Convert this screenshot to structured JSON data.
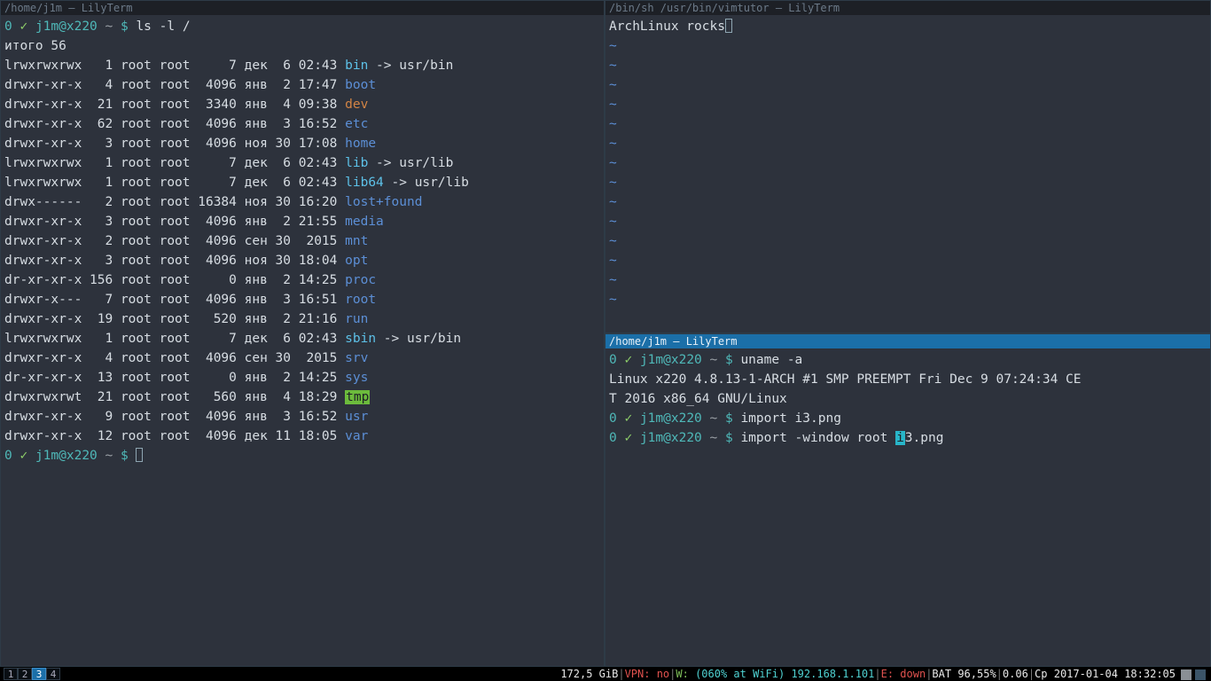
{
  "titles": {
    "left": "/home/j1m – LilyTerm",
    "topright": "/bin/sh /usr/bin/vimtutor – LilyTerm",
    "bottomright": "/home/j1m – LilyTerm"
  },
  "prompt": {
    "zero": "0",
    "check": "✓",
    "user": "j1m@x220",
    "path": "~",
    "sym": "$"
  },
  "left": {
    "cmd1": "ls -l /",
    "total": "итого 56",
    "rows": [
      {
        "perm": "lrwxrwxrwx",
        "n": "1",
        "own": "root",
        "grp": "root",
        "size": "7",
        "mon": "дек",
        "day": "6",
        "time": "02:43",
        "name": "bin",
        "link": " -> usr/bin",
        "cls": "fg-cyan"
      },
      {
        "perm": "drwxr-xr-x",
        "n": "4",
        "own": "root",
        "grp": "root",
        "size": "4096",
        "mon": "янв",
        "day": "2",
        "time": "17:47",
        "name": "boot",
        "link": "",
        "cls": "fg-blue"
      },
      {
        "perm": "drwxr-xr-x",
        "n": "21",
        "own": "root",
        "grp": "root",
        "size": "3340",
        "mon": "янв",
        "day": "4",
        "time": "09:38",
        "name": "dev",
        "link": "",
        "cls": "fg-orange"
      },
      {
        "perm": "drwxr-xr-x",
        "n": "62",
        "own": "root",
        "grp": "root",
        "size": "4096",
        "mon": "янв",
        "day": "3",
        "time": "16:52",
        "name": "etc",
        "link": "",
        "cls": "fg-blue"
      },
      {
        "perm": "drwxr-xr-x",
        "n": "3",
        "own": "root",
        "grp": "root",
        "size": "4096",
        "mon": "ноя",
        "day": "30",
        "time": "17:08",
        "name": "home",
        "link": "",
        "cls": "fg-blue"
      },
      {
        "perm": "lrwxrwxrwx",
        "n": "1",
        "own": "root",
        "grp": "root",
        "size": "7",
        "mon": "дек",
        "day": "6",
        "time": "02:43",
        "name": "lib",
        "link": " -> usr/lib",
        "cls": "fg-cyan"
      },
      {
        "perm": "lrwxrwxrwx",
        "n": "1",
        "own": "root",
        "grp": "root",
        "size": "7",
        "mon": "дек",
        "day": "6",
        "time": "02:43",
        "name": "lib64",
        "link": " -> usr/lib",
        "cls": "fg-cyan"
      },
      {
        "perm": "drwx------",
        "n": "2",
        "own": "root",
        "grp": "root",
        "size": "16384",
        "mon": "ноя",
        "day": "30",
        "time": "16:20",
        "name": "lost+found",
        "link": "",
        "cls": "fg-blue"
      },
      {
        "perm": "drwxr-xr-x",
        "n": "3",
        "own": "root",
        "grp": "root",
        "size": "4096",
        "mon": "янв",
        "day": "2",
        "time": "21:55",
        "name": "media",
        "link": "",
        "cls": "fg-blue"
      },
      {
        "perm": "drwxr-xr-x",
        "n": "2",
        "own": "root",
        "grp": "root",
        "size": "4096",
        "mon": "сен",
        "day": "30",
        "time": "2015",
        "name": "mnt",
        "link": "",
        "cls": "fg-blue"
      },
      {
        "perm": "drwxr-xr-x",
        "n": "3",
        "own": "root",
        "grp": "root",
        "size": "4096",
        "mon": "ноя",
        "day": "30",
        "time": "18:04",
        "name": "opt",
        "link": "",
        "cls": "fg-blue"
      },
      {
        "perm": "dr-xr-xr-x",
        "n": "156",
        "own": "root",
        "grp": "root",
        "size": "0",
        "mon": "янв",
        "day": "2",
        "time": "14:25",
        "name": "proc",
        "link": "",
        "cls": "fg-blue"
      },
      {
        "perm": "drwxr-x---",
        "n": "7",
        "own": "root",
        "grp": "root",
        "size": "4096",
        "mon": "янв",
        "day": "3",
        "time": "16:51",
        "name": "root",
        "link": "",
        "cls": "fg-blue"
      },
      {
        "perm": "drwxr-xr-x",
        "n": "19",
        "own": "root",
        "grp": "root",
        "size": "520",
        "mon": "янв",
        "day": "2",
        "time": "21:16",
        "name": "run",
        "link": "",
        "cls": "fg-blue"
      },
      {
        "perm": "lrwxrwxrwx",
        "n": "1",
        "own": "root",
        "grp": "root",
        "size": "7",
        "mon": "дек",
        "day": "6",
        "time": "02:43",
        "name": "sbin",
        "link": " -> usr/bin",
        "cls": "fg-cyan"
      },
      {
        "perm": "drwxr-xr-x",
        "n": "4",
        "own": "root",
        "grp": "root",
        "size": "4096",
        "mon": "сен",
        "day": "30",
        "time": "2015",
        "name": "srv",
        "link": "",
        "cls": "fg-blue"
      },
      {
        "perm": "dr-xr-xr-x",
        "n": "13",
        "own": "root",
        "grp": "root",
        "size": "0",
        "mon": "янв",
        "day": "2",
        "time": "14:25",
        "name": "sys",
        "link": "",
        "cls": "fg-blue"
      },
      {
        "perm": "drwxrwxrwt",
        "n": "21",
        "own": "root",
        "grp": "root",
        "size": "560",
        "mon": "янв",
        "day": "4",
        "time": "18:29",
        "name": "tmp",
        "link": "",
        "cls": "bg-green"
      },
      {
        "perm": "drwxr-xr-x",
        "n": "9",
        "own": "root",
        "grp": "root",
        "size": "4096",
        "mon": "янв",
        "day": "3",
        "time": "16:52",
        "name": "usr",
        "link": "",
        "cls": "fg-blue"
      },
      {
        "perm": "drwxr-xr-x",
        "n": "12",
        "own": "root",
        "grp": "root",
        "size": "4096",
        "mon": "дек",
        "day": "11",
        "time": "18:05",
        "name": "var",
        "link": "",
        "cls": "fg-blue"
      }
    ]
  },
  "vim": {
    "text": "ArchLinux rocks"
  },
  "br": {
    "cmd1": "uname -a",
    "out1a": "Linux x220 4.8.13-1-ARCH #1 SMP PREEMPT Fri Dec 9 07:24:34 CE",
    "out1b": "T 2016 x86_64 GNU/Linux",
    "cmd2": "import i3.png",
    "cmd3a": "import -window root ",
    "cmd3b": "i",
    "cmd3c": "3.png"
  },
  "bar": {
    "workspaces": [
      "1",
      "2",
      "3",
      "4"
    ],
    "active": 2,
    "disk": "172,5 GiB",
    "vpn_label": "VPN:",
    "vpn_val": "no",
    "w_label": "W:",
    "w_val": "(060% at WiFi) 192.168.1.101",
    "e_label": "E:",
    "e_val": "down",
    "bat": "BAT 96,55%",
    "load": "0.06",
    "date": "Ср 2017-01-04 18:32:05"
  }
}
